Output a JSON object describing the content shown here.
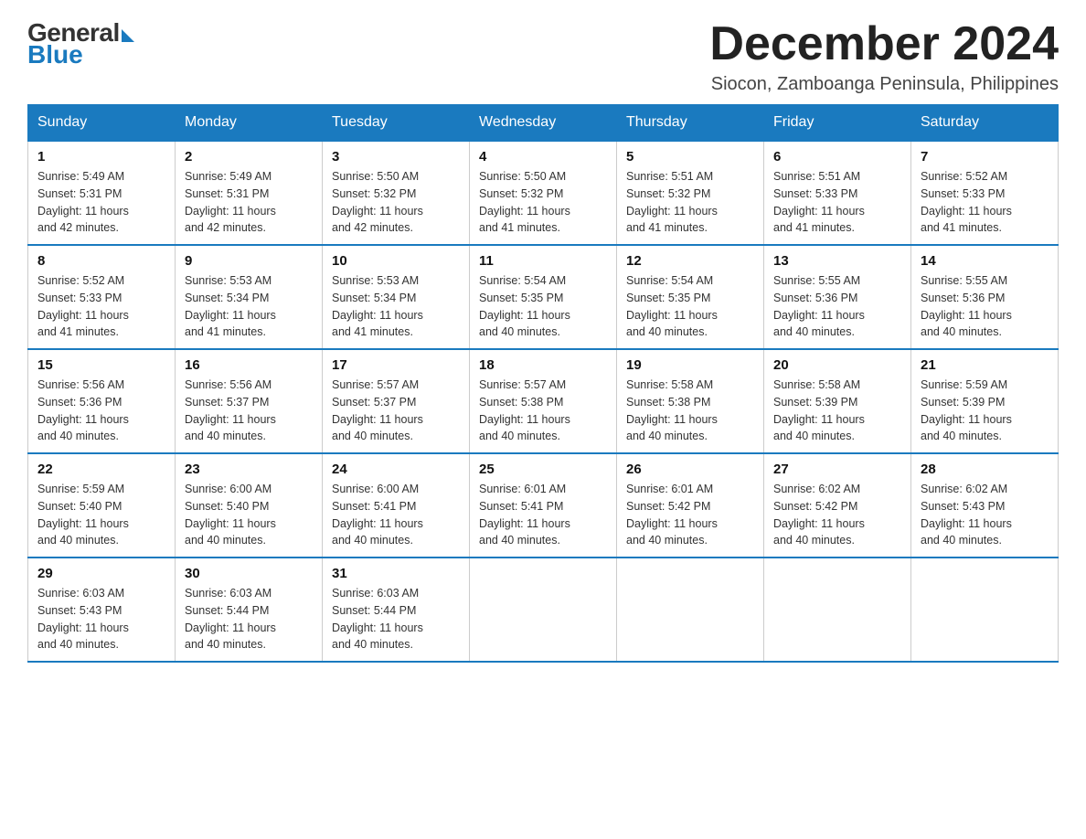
{
  "logo": {
    "general": "General",
    "blue": "Blue"
  },
  "title": "December 2024",
  "subtitle": "Siocon, Zamboanga Peninsula, Philippines",
  "weekdays": [
    "Sunday",
    "Monday",
    "Tuesday",
    "Wednesday",
    "Thursday",
    "Friday",
    "Saturday"
  ],
  "weeks": [
    [
      {
        "day": "1",
        "sunrise": "5:49 AM",
        "sunset": "5:31 PM",
        "daylight": "11 hours and 42 minutes."
      },
      {
        "day": "2",
        "sunrise": "5:49 AM",
        "sunset": "5:31 PM",
        "daylight": "11 hours and 42 minutes."
      },
      {
        "day": "3",
        "sunrise": "5:50 AM",
        "sunset": "5:32 PM",
        "daylight": "11 hours and 42 minutes."
      },
      {
        "day": "4",
        "sunrise": "5:50 AM",
        "sunset": "5:32 PM",
        "daylight": "11 hours and 41 minutes."
      },
      {
        "day": "5",
        "sunrise": "5:51 AM",
        "sunset": "5:32 PM",
        "daylight": "11 hours and 41 minutes."
      },
      {
        "day": "6",
        "sunrise": "5:51 AM",
        "sunset": "5:33 PM",
        "daylight": "11 hours and 41 minutes."
      },
      {
        "day": "7",
        "sunrise": "5:52 AM",
        "sunset": "5:33 PM",
        "daylight": "11 hours and 41 minutes."
      }
    ],
    [
      {
        "day": "8",
        "sunrise": "5:52 AM",
        "sunset": "5:33 PM",
        "daylight": "11 hours and 41 minutes."
      },
      {
        "day": "9",
        "sunrise": "5:53 AM",
        "sunset": "5:34 PM",
        "daylight": "11 hours and 41 minutes."
      },
      {
        "day": "10",
        "sunrise": "5:53 AM",
        "sunset": "5:34 PM",
        "daylight": "11 hours and 41 minutes."
      },
      {
        "day": "11",
        "sunrise": "5:54 AM",
        "sunset": "5:35 PM",
        "daylight": "11 hours and 40 minutes."
      },
      {
        "day": "12",
        "sunrise": "5:54 AM",
        "sunset": "5:35 PM",
        "daylight": "11 hours and 40 minutes."
      },
      {
        "day": "13",
        "sunrise": "5:55 AM",
        "sunset": "5:36 PM",
        "daylight": "11 hours and 40 minutes."
      },
      {
        "day": "14",
        "sunrise": "5:55 AM",
        "sunset": "5:36 PM",
        "daylight": "11 hours and 40 minutes."
      }
    ],
    [
      {
        "day": "15",
        "sunrise": "5:56 AM",
        "sunset": "5:36 PM",
        "daylight": "11 hours and 40 minutes."
      },
      {
        "day": "16",
        "sunrise": "5:56 AM",
        "sunset": "5:37 PM",
        "daylight": "11 hours and 40 minutes."
      },
      {
        "day": "17",
        "sunrise": "5:57 AM",
        "sunset": "5:37 PM",
        "daylight": "11 hours and 40 minutes."
      },
      {
        "day": "18",
        "sunrise": "5:57 AM",
        "sunset": "5:38 PM",
        "daylight": "11 hours and 40 minutes."
      },
      {
        "day": "19",
        "sunrise": "5:58 AM",
        "sunset": "5:38 PM",
        "daylight": "11 hours and 40 minutes."
      },
      {
        "day": "20",
        "sunrise": "5:58 AM",
        "sunset": "5:39 PM",
        "daylight": "11 hours and 40 minutes."
      },
      {
        "day": "21",
        "sunrise": "5:59 AM",
        "sunset": "5:39 PM",
        "daylight": "11 hours and 40 minutes."
      }
    ],
    [
      {
        "day": "22",
        "sunrise": "5:59 AM",
        "sunset": "5:40 PM",
        "daylight": "11 hours and 40 minutes."
      },
      {
        "day": "23",
        "sunrise": "6:00 AM",
        "sunset": "5:40 PM",
        "daylight": "11 hours and 40 minutes."
      },
      {
        "day": "24",
        "sunrise": "6:00 AM",
        "sunset": "5:41 PM",
        "daylight": "11 hours and 40 minutes."
      },
      {
        "day": "25",
        "sunrise": "6:01 AM",
        "sunset": "5:41 PM",
        "daylight": "11 hours and 40 minutes."
      },
      {
        "day": "26",
        "sunrise": "6:01 AM",
        "sunset": "5:42 PM",
        "daylight": "11 hours and 40 minutes."
      },
      {
        "day": "27",
        "sunrise": "6:02 AM",
        "sunset": "5:42 PM",
        "daylight": "11 hours and 40 minutes."
      },
      {
        "day": "28",
        "sunrise": "6:02 AM",
        "sunset": "5:43 PM",
        "daylight": "11 hours and 40 minutes."
      }
    ],
    [
      {
        "day": "29",
        "sunrise": "6:03 AM",
        "sunset": "5:43 PM",
        "daylight": "11 hours and 40 minutes."
      },
      {
        "day": "30",
        "sunrise": "6:03 AM",
        "sunset": "5:44 PM",
        "daylight": "11 hours and 40 minutes."
      },
      {
        "day": "31",
        "sunrise": "6:03 AM",
        "sunset": "5:44 PM",
        "daylight": "11 hours and 40 minutes."
      },
      null,
      null,
      null,
      null
    ]
  ],
  "labels": {
    "sunrise": "Sunrise:",
    "sunset": "Sunset:",
    "daylight": "Daylight:"
  }
}
